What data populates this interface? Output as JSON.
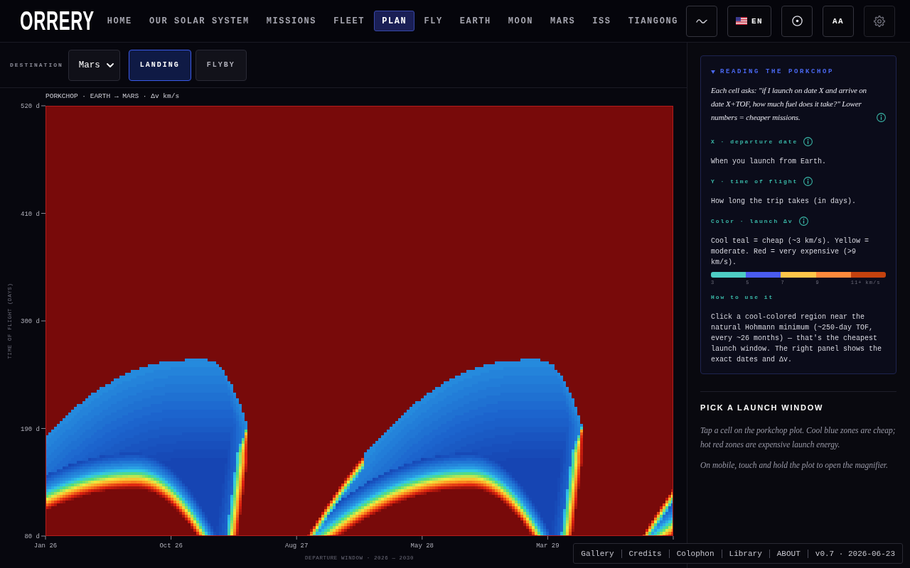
{
  "header": {
    "logo": "ORRERY",
    "nav": [
      {
        "label": "HOME",
        "selected": false
      },
      {
        "label": "OUR SOLAR SYSTEM",
        "selected": false
      },
      {
        "label": "MISSIONS",
        "selected": false
      },
      {
        "label": "FLEET",
        "selected": false
      },
      {
        "label": "PLAN",
        "selected": true
      },
      {
        "label": "FLY",
        "selected": false
      },
      {
        "label": "EARTH",
        "selected": false
      },
      {
        "label": "MOON",
        "selected": false
      },
      {
        "label": "MARS",
        "selected": false
      },
      {
        "label": "ISS",
        "selected": false
      },
      {
        "label": "TIANGONG",
        "selected": false
      }
    ],
    "tools": [
      {
        "kind": "wave"
      },
      {
        "kind": "language",
        "label": "EN"
      },
      {
        "kind": "target"
      },
      {
        "kind": "text",
        "label": "AA"
      },
      {
        "kind": "settings"
      }
    ]
  },
  "toolbar": {
    "destination_label": "DESTINATION",
    "destination": "Mars",
    "modes": [
      {
        "label": "LANDING",
        "selected": true
      },
      {
        "label": "FLYBY",
        "selected": false
      }
    ]
  },
  "plot": {
    "title": "PORKCHOP · EARTH → MARS · Δv km/s",
    "y_axis_label": "TIME OF FLIGHT (DAYS)",
    "y_ticks": [
      "520 d",
      "410 d",
      "300 d",
      "190 d",
      "80 d"
    ],
    "x_ticks": [
      "Jan 26",
      "Oct 26",
      "Aug 27",
      "May 28",
      "Mar 29"
    ],
    "x_axis_label": "DEPARTURE WINDOW · 2026 — 2030"
  },
  "guide": {
    "title": "READING THE PORKCHOP",
    "expanded": true,
    "intro": {
      "text": "Each cell asks: \"if I launch on date X and arrive on date X+TOF, how much fuel does it take?\" Lower numbers = cheaper missions.",
      "info": true
    },
    "sections": [
      {
        "heading": "X · departure date",
        "info": true,
        "body": "When you launch from Earth."
      },
      {
        "heading": "Y · time of flight",
        "info": true,
        "body": "How long the trip takes (in days)."
      },
      {
        "heading": "Color · launch Δv",
        "info": true,
        "body": "Cool teal = cheap (~3 km/s). Yellow = moderate. Red = very expensive (>9 km/s).",
        "legend": [
          {
            "color": "#4ecdc4",
            "label": "3"
          },
          {
            "color": "#4a5cf0",
            "label": "5"
          },
          {
            "color": "#ffc64a",
            "label": "7"
          },
          {
            "color": "#ff8a3c",
            "label": "9"
          },
          {
            "color": "#c4420e",
            "label": "11+ km/s"
          }
        ]
      },
      {
        "heading": "How to use it",
        "info": false,
        "body": "Click a cool-colored region near the natural Hohmann minimum (~250-day TOF, every ~26 months) — that's the cheapest launch window. The right panel shows the exact dates and Δv."
      }
    ]
  },
  "launch_window": {
    "title": "PICK A LAUNCH WINDOW",
    "paragraphs": [
      "Tap a cell on the porkchop plot. Cool blue zones are cheap; hot red zones are expensive launch energy.",
      "On mobile, touch and hold the plot to open the magnifier."
    ]
  },
  "footer": {
    "links": [
      "Gallery",
      "Credits",
      "Colophon",
      "Library",
      "ABOUT"
    ],
    "version": "v0.7 · 2026-06-23"
  }
}
